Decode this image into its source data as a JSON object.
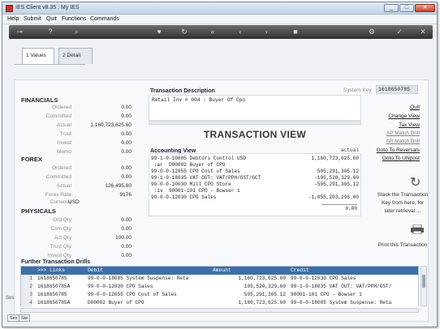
{
  "window": {
    "title": "IES Client v8.35 : My IES",
    "min": "_",
    "max": "□",
    "close": "✕"
  },
  "menu": [
    "Help",
    "Submit",
    "Quit",
    "Functions",
    "Commands"
  ],
  "toolbar_icons": [
    "key-icon",
    "help-icon",
    "search-icon",
    "heart-icon",
    "refresh-icon",
    "rewind-icon",
    "back-icon",
    "forward-icon",
    "stop-icon",
    "settings-icon",
    "check-icon",
    "close-icon"
  ],
  "tabs": {
    "values": "1 Values",
    "detail": "2 Detail"
  },
  "financials": {
    "title": "FINANCIALS",
    "rows": [
      {
        "label": "Ordered",
        "value": "0.00"
      },
      {
        "label": "Committed",
        "value": "0.00"
      },
      {
        "label": "Actual",
        "value": "1,160,723,625.60"
      },
      {
        "label": "Trust",
        "value": "0.00"
      },
      {
        "label": "Invest",
        "value": "0.00"
      },
      {
        "label": "Memo",
        "value": "0.00"
      }
    ]
  },
  "forex": {
    "title": "FOREX",
    "rows": [
      {
        "label": "Ordered",
        "value": "0.00"
      },
      {
        "label": "Committed",
        "value": "0.00"
      },
      {
        "label": "Actual",
        "value": "126,495.60"
      },
      {
        "label": "Forex Rate",
        "value": "9176"
      },
      {
        "label": "Currency",
        "value": "USD"
      }
    ]
  },
  "physicals": {
    "title": "PHYSICALS",
    "rows": [
      {
        "label": "Ord Qty",
        "value": "0.00"
      },
      {
        "label": "Com Qty",
        "value": "0.00"
      },
      {
        "label": "Act Qty",
        "value": "100.00"
      },
      {
        "label": "Trust Qty",
        "value": "0.00"
      },
      {
        "label": "Invest Qty",
        "value": "0.00"
      }
    ]
  },
  "transaction": {
    "desc_label": "Transaction Description",
    "description": "Retail Inv # 004 : Buyer Of Cpo",
    "syskey_label": "System Key",
    "syskey": "1618650785",
    "view_title": "TRANSACTION VIEW",
    "acct_label": "Accounting View",
    "actual_header": "actual",
    "lines": [
      {
        "text": "99-1-0-10005 Debtors Control USD",
        "value": "1,160,723,625.60"
      },
      {
        "text": " :ar  D00002 Buyer of CPO",
        "value": ""
      },
      {
        "text": "99-0-0-12055 CPO Cost of Sales",
        "value": "505,291,305.12"
      },
      {
        "text": "99-1-0-18035 VAT OUT: VAT/PPH/GST/GCT",
        "value": "-105,520,329.60"
      },
      {
        "text": "99-0-0-10030 Mill CPO Store",
        "value": "-505,291,305.12"
      },
      {
        "text": " :iv  90001-101 CPO - Bowser 1",
        "value": ""
      },
      {
        "text": "99-0-0-12030 CPO Sales",
        "value": "-1,055,203,296.00"
      }
    ],
    "total": "0.00"
  },
  "actions": {
    "quit": "Quit",
    "change_view": "Change View",
    "tax_view": "Tax View",
    "ap_match": "AP Match Drill",
    "ar_match": "AR Match Drill",
    "goto_reversals": "Goto To Reversals",
    "goto_unpost": "Goto To UNpost",
    "stack_text": "Stack the Transaction Key from here, for later retrieval ...",
    "print_text": "Print this Transaction"
  },
  "drills": {
    "title": "Further Transaction Drills",
    "headers": [
      ">>> Links",
      "Debit",
      "Amount",
      "Credit"
    ],
    "rows": [
      {
        "n": "1",
        "link": "1618650785",
        "debit": "99-0-0-18085 System Suspense: Reta",
        "amount": "1,160,723,625.60",
        "credit": "99-0-0-12030 CPO Sales"
      },
      {
        "n": "2",
        "link": "1618650785A",
        "debit": "99-0-0-12030 CPO Sales",
        "amount": "105,520,329.60",
        "credit": "99-1-0-18035 VAT OUT: VAT/PPH/GST/"
      },
      {
        "n": "3",
        "link": "1618650785",
        "debit": "99-0-0-12055 CPO Cost of Sales",
        "amount": "505,291,305.12",
        "credit": "90001-101 CPO - Bowser 1"
      },
      {
        "n": "4",
        "link": "1618650785A",
        "debit": "D00002 Buyer of CPO",
        "amount": "1,160,723,625.60",
        "credit": "99-0-0-18085 System Suspense: Reta"
      }
    ]
  },
  "bottom_tabs": [
    "Sex",
    "Ste"
  ],
  "side_label": "Ses"
}
